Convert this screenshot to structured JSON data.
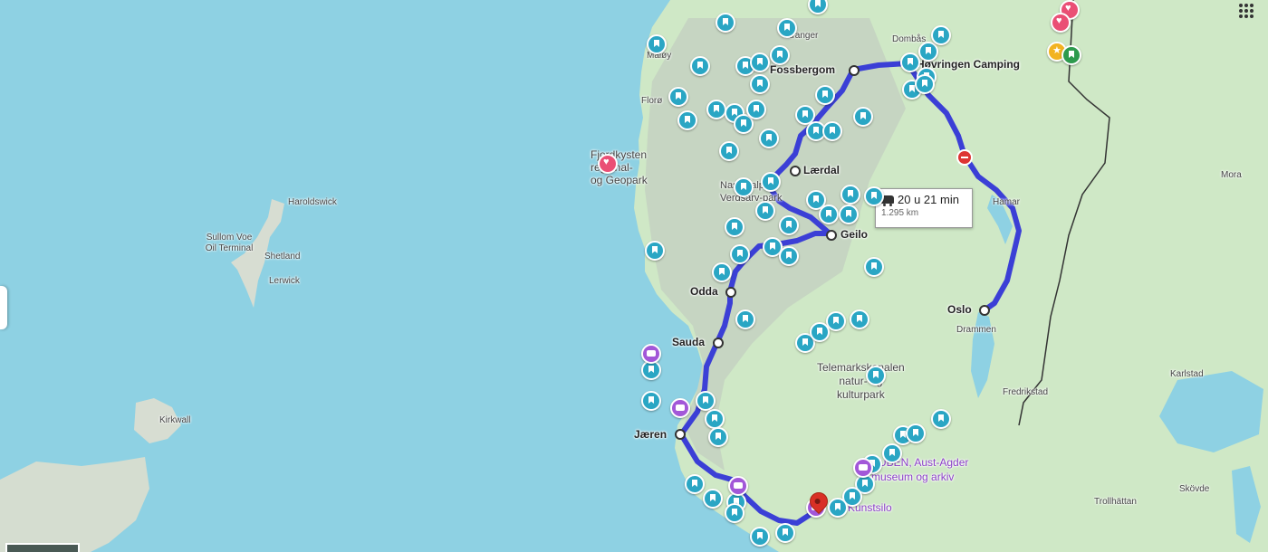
{
  "route": {
    "duration": "20 u 21 min",
    "distance": "1.295 km",
    "color": "#3b3fd6"
  },
  "stops": {
    "fossbergom": "Fossbergom",
    "hovringen": "Høvringen Camping",
    "laerdal": "Lærdal",
    "geilo": "Geilo",
    "odda": "Odda",
    "sauda": "Sauda",
    "jaeren": "Jæren",
    "oslo": "Oslo"
  },
  "places": {
    "haroldswick": "Haroldswick",
    "sullom_voe": "Sullom Voe\nOil Terminal",
    "shetland": "Shetland",
    "lerwick": "Lerwick",
    "kirkwall": "Kirkwall",
    "maloy": "Måløy",
    "floro": "Florø",
    "fjordkysten": "Fjordkysten\nregional-\nog Geopark",
    "dombas": "Dombås",
    "stranger": "Stranger",
    "nasjonal": "Nasjonalpark\nVerdsarv-park",
    "hamar": "Hamar",
    "mora": "Mora",
    "drammen": "Drammen",
    "fredrikstad": "Fredrikstad",
    "karlstad": "Karlstad",
    "trollhattan": "Trollhättan",
    "skovde": "Skövde",
    "telemark": "Telemarkskanalen\nnatur- og\nkulturpark",
    "agder": "KUBEN, Aust-Agder\nmuseum og arkiv",
    "kristsilo": "Kunstsilo"
  },
  "icons": {
    "poi": "bookmark-icon",
    "photo": "camera-icon",
    "saved": "heart-icon",
    "starred": "star-icon",
    "pin": "destination-pin-icon",
    "noentry": "no-entry-icon",
    "car": "car-icon",
    "apps": "apps-grid-icon"
  },
  "colors": {
    "water": "#8ed1e3",
    "land": "#cfe8c6",
    "poi_marker": "#2aa6c4",
    "photo_marker": "#a257d8",
    "saved_marker": "#ea4f75"
  }
}
